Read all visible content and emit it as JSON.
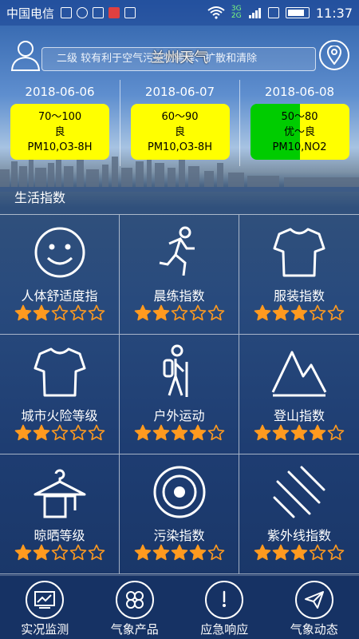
{
  "status": {
    "carrier": "中国电信",
    "time": "11:37",
    "network": "3G 2G"
  },
  "header": {
    "city": "兰州天气",
    "notice": "二级 较有利于空气污染物稀释、扩散和清除"
  },
  "forecast": [
    {
      "date": "2018-06-06",
      "aqi": "70～100",
      "level": "良",
      "pollutant": "PM10,O3-8H",
      "color": "#ffff00"
    },
    {
      "date": "2018-06-07",
      "aqi": "60～90",
      "level": "良",
      "pollutant": "PM10,O3-8H",
      "color": "#ffff00"
    },
    {
      "date": "2018-06-08",
      "aqi": "50～80",
      "level": "优～良",
      "pollutant": "PM10,NO2",
      "color": "#00cc00"
    }
  ],
  "life": {
    "title": "生活指数",
    "items": [
      {
        "label": "人体舒适度指",
        "icon": "smiley-icon",
        "rating": 2
      },
      {
        "label": "晨练指数",
        "icon": "runner-icon",
        "rating": 2
      },
      {
        "label": "服装指数",
        "icon": "tshirt-icon",
        "rating": 3
      },
      {
        "label": "城市火险等级",
        "icon": "tshirt-icon",
        "rating": 2
      },
      {
        "label": "户外运动",
        "icon": "hiker-icon",
        "rating": 4
      },
      {
        "label": "登山指数",
        "icon": "mountain-icon",
        "rating": 4
      },
      {
        "label": "晾晒等级",
        "icon": "hanger-icon",
        "rating": 2
      },
      {
        "label": "污染指数",
        "icon": "target-icon",
        "rating": 4
      },
      {
        "label": "紫外线指数",
        "icon": "uv-lines-icon",
        "rating": 3
      }
    ]
  },
  "nav": [
    {
      "label": "实况监测",
      "icon": "monitor-chart-icon"
    },
    {
      "label": "气象产品",
      "icon": "clover-icon"
    },
    {
      "label": "应急响应",
      "icon": "gauge-icon"
    },
    {
      "label": "气象动态",
      "icon": "paper-plane-icon"
    }
  ],
  "colors": {
    "star": "#ff9a1f",
    "accent_yellow": "#ffff00",
    "accent_green": "#00cc00"
  }
}
